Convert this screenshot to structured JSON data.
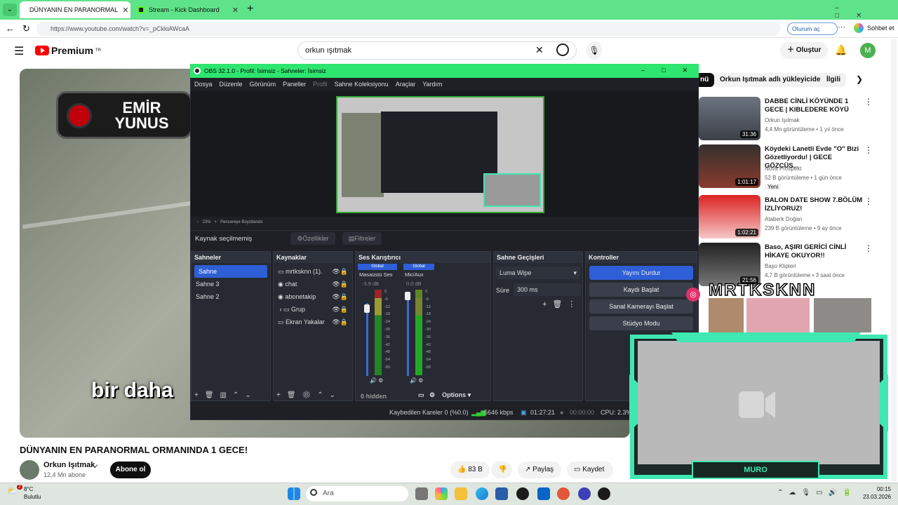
{
  "browser": {
    "tabs": [
      {
        "label": "DÜNYANIN EN PARANORMAL",
        "active": true
      },
      {
        "label": "Stream - Kick Dashboard",
        "active": false
      }
    ],
    "url": "https://www.youtube.com/watch?v=_pCkkiAWcaA",
    "signin": "Oturum aç",
    "chat": "Sohbet et"
  },
  "youtube": {
    "logo": "Premium",
    "logo_sup": "TR",
    "search_value": "orkun ışıtmak",
    "create": "Oluştur",
    "avatar": "M",
    "video_title": "DÜNYANIN EN PARANORMAL ORMANINDA 1 GECE!",
    "channel_name": "Orkun Işıtmak",
    "channel_subs": "12,4 Mn abone",
    "subscribe": "Abone ol",
    "likes": "83 B",
    "share": "Paylaş",
    "save": "Kaydet",
    "overlay_name_1": "EMİR",
    "overlay_name_2": "YUNUS",
    "subtitle": "bir daha",
    "chips": [
      "nü",
      "Orkun Işıtmak adlı yükleyiciden",
      "İlgili"
    ],
    "related": [
      {
        "title": "DABBE CİNLİ KÖYÜNDE 1 GECE | KIBLEDERE KÖYÜ",
        "channel": "Orkun Işıtmak",
        "meta": "4,4 Mn görüntüleme • 1 yıl önce",
        "duration": "31:36"
      },
      {
        "title": "Köydeki Lanetli Evde \"O\" Bizi Gözetliyordu! | GECE GÖZCÜS...",
        "channel": "Nova Prospekt",
        "meta": "52 B görüntüleme • 1 gün önce",
        "badge": "Yeni",
        "duration": "1:01:17"
      },
      {
        "title": "BALON DATE SHOW 7.BÖLÜM İZLİYORUZ!",
        "channel": "Ataberk Doğan",
        "meta": "239 B görüntüleme • 9 ay önce",
        "duration": "1:02:21"
      },
      {
        "title": "Baso, AŞIRI GERİCİ CİNLİ HİKAYE OKUYOR!!",
        "channel": "Başo Klipleri",
        "meta": "4,7 B görüntüleme • 3 saat önce",
        "duration": "21:56"
      }
    ]
  },
  "obs": {
    "title": "OBS 32.1.0 - Profil: İsimsiz - Sahneler: İsimsiz",
    "menu": [
      "Dosya",
      "Düzenle",
      "Görünüm",
      "Paneller",
      "Profil",
      "Sahne Koleksiyonu",
      "Araçlar",
      "Yardım"
    ],
    "zoom": "23%",
    "fit_label": "Pencereye Boyutlandır",
    "no_source": "Kaynak seçilmemiş",
    "properties": "Özellikler",
    "filters": "Filtreler",
    "scenes_title": "Sahneler",
    "scenes": [
      "Sahne",
      "Sahne 3",
      "Sahne 2"
    ],
    "sources_title": "Kaynaklar",
    "sources": [
      "mrtksknn (1).",
      "chat",
      "abonetakip",
      "Grup",
      "Ekran Yakalar"
    ],
    "mixer_title": "Ses Karıştırıcı",
    "mixer_channels": [
      {
        "tag": "Global",
        "name": "Masaüstü Ses",
        "db": "-3.9 dB"
      },
      {
        "tag": "Global",
        "name": "Mic/Aux",
        "db": "0.0 dB"
      }
    ],
    "mixer_scale": [
      "0",
      "-6",
      "-12",
      "-18",
      "-24",
      "-30",
      "-36",
      "-42",
      "-48",
      "-54",
      "-60"
    ],
    "mixer_hidden": "0 hidden",
    "mixer_options": "Options",
    "transitions_title": "Sahne Geçişleri",
    "transition": "Luma Wipe",
    "duration_label": "Süre",
    "duration_value": "300 ms",
    "controls_title": "Kontroller",
    "controls": [
      "Yayını Durdur",
      "Kaydı Başlat",
      "Sanal Kamerayı Başlat",
      "Stüdyo Modu"
    ],
    "status_dropped": "Kaybedilen Kareler 0 (%0.0)",
    "status_kbps": "5646 kbps",
    "status_live": "01:27:21",
    "status_rec": "00:00:00",
    "status_cpu": "CPU: 2.3%"
  },
  "stream_overlay": {
    "cam_name": "MRTKSKNN",
    "footer_name": "MURO"
  },
  "taskbar": {
    "weather_temp": "8°C",
    "weather_desc": "Bulutlu",
    "search": "Ara",
    "time": "00:15",
    "date": "23.03.2026",
    "notif_count": "2"
  },
  "colors": {
    "obs_green": "#2ee56f",
    "accent_blue": "#2e5fd6",
    "yt_red": "#ff0000",
    "overlay_teal": "#3ee8b0"
  }
}
